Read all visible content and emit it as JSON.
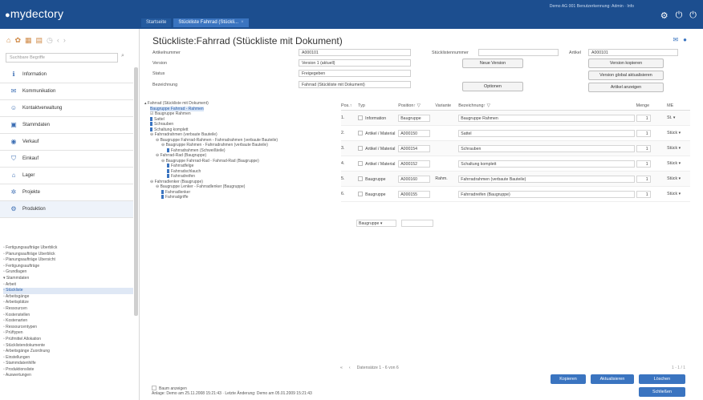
{
  "app": {
    "logo": "mydectory",
    "user_info": "Demo AG 001 Benutzerkennung: Admin · Info"
  },
  "tabs": [
    {
      "label": "Startseite"
    },
    {
      "label": "Stückliste Fahrrad (Stückli...",
      "close": "×"
    }
  ],
  "sidebar": {
    "search_placeholder": "Suchbare Begriffe",
    "items": [
      {
        "icon": "info-icon",
        "label": "Information"
      },
      {
        "icon": "communication-icon",
        "label": "Kommunikation"
      },
      {
        "icon": "contacts-icon",
        "label": "Kontaktverwaltung"
      },
      {
        "icon": "masterdata-icon",
        "label": "Stammdaten"
      },
      {
        "icon": "sales-icon",
        "label": "Verkauf"
      },
      {
        "icon": "purchase-icon",
        "label": "Einkauf"
      },
      {
        "icon": "warehouse-icon",
        "label": "Lager"
      },
      {
        "icon": "projects-icon",
        "label": "Projekte"
      },
      {
        "icon": "production-icon",
        "label": "Produktion"
      }
    ],
    "tree": [
      "▫ Fertigungsaufträge Überblick",
      "▫ Planungsaufträge Überblick",
      "▫ Planungsaufträge Übersicht",
      "▫ Fertigungsaufträge",
      "  ▫ Grundlagen",
      "  ▾ Stammdaten",
      "    ▫ Arbeit",
      "    ▫ Stückliste",
      "    ▫ Arbeitsgänge",
      "    ▫ Arbeitsplätze",
      "    ▫ Ressourcen",
      "    ▫ Kostenstellen",
      "    ▫ Kostenarten",
      "    ▫ Ressourcentypen",
      "    ▫ Prüftypen",
      "    ▫ Prüfmittel Allokation",
      "    ▫ Stücklistendokumente",
      "    ▫ Arbeitsgänge Zuordnung",
      "  ▫ Einstellungen",
      "  ▫ Stammdatenhilfe",
      "▫ Produktionsliste",
      "▫ Auswertungen"
    ],
    "tree_selected": 7
  },
  "main": {
    "title": "Stückliste:Fahrrad (Stückliste mit Dokument)",
    "fields": {
      "artikelnummer_label": "Artikelnummer",
      "artikelnummer": "A000101",
      "version_label": "Version",
      "version": "Version 1 (aktuell)",
      "status_label": "Status",
      "status": "Freigegeben",
      "bezeichnung_label": "Bezeichnung",
      "bezeichnung": "Fahrrad (Stückliste mit Dokument)",
      "stuecklistennummer_label": "Stücklistennummer",
      "stuecklistennummer": "",
      "artikel_label": "Artikel",
      "artikel": "A000101"
    },
    "buttons": {
      "neue_version": "Neue Version",
      "optionen": "Optionen",
      "version_kopieren": "Version kopieren",
      "version_global": "Version global aktualisieren",
      "artikel_anzeigen": "Artikel anzeigen"
    },
    "tree": [
      {
        "t": "▴ Fahrrad (Stückliste mit Dokument)",
        "i": 0,
        "sel": false
      },
      {
        "t": "Baugruppe Fahrrad - Rahmen",
        "i": 1,
        "sel": true
      },
      {
        "t": "☑ Baugruppe Rahmen",
        "i": 1,
        "sel": false
      },
      {
        "t": "Sattel",
        "i": 1,
        "leaf": true
      },
      {
        "t": "Schrauben",
        "i": 1,
        "leaf": true
      },
      {
        "t": "Schaltung komplett",
        "i": 1,
        "leaf": true
      },
      {
        "t": "⊖ Fahrradrahmen (verbaute Bauteile)",
        "i": 1
      },
      {
        "t": "⊖ Baugruppe Fahrrad-Rahmen - Fahrradrahmen (verbaute Bauteile)",
        "i": 2
      },
      {
        "t": "⊖ Baugruppe Rahmen - Fahrradrahmen (verbaute Bauteile)",
        "i": 3
      },
      {
        "t": "Fahrradrahmen (Schweißteile)",
        "i": 4,
        "leaf": true
      },
      {
        "t": "⊖ Fahrrad-Rad (Baugruppe)",
        "i": 2
      },
      {
        "t": "⊖ Baugruppe Fahrrad-Rad - Fahrrad-Rad (Baugruppe)",
        "i": 3
      },
      {
        "t": "Fahrradfelge",
        "i": 4,
        "leaf": true
      },
      {
        "t": "Fahrradschlauch",
        "i": 4,
        "leaf": true
      },
      {
        "t": "Fahrradreifen",
        "i": 4,
        "leaf": true
      },
      {
        "t": "⊖ Fahrradlenker (Baugruppe)",
        "i": 1
      },
      {
        "t": "⊖ Baugruppe Lenker - Fahrradlenker (Baugruppe)",
        "i": 2
      },
      {
        "t": "Fahrradlenker",
        "i": 3,
        "leaf": true
      },
      {
        "t": "Fahrradgriffe",
        "i": 3,
        "leaf": true
      }
    ],
    "table": {
      "headers": [
        "Pos.↑",
        "Typ",
        "Position↑ ▽",
        "Variante",
        "Bezeichnung↑ ▽",
        "Menge",
        "ME"
      ],
      "rows": [
        {
          "pos": "1.",
          "typ": "Information",
          "position": "Baugruppe",
          "variante": "",
          "bez": "Baugruppe Rahmen",
          "menge": "1",
          "me": "St."
        },
        {
          "pos": "2.",
          "typ": "Artikel / Material",
          "position": "A000150",
          "variante": "",
          "bez": "Sattel",
          "menge": "1",
          "me": "Stück"
        },
        {
          "pos": "3.",
          "typ": "Artikel / Material",
          "position": "A000154",
          "variante": "",
          "bez": "Schrauben",
          "menge": "1",
          "me": "Stück"
        },
        {
          "pos": "4.",
          "typ": "Artikel / Material",
          "position": "A000152",
          "variante": "",
          "bez": "Schaltung komplett",
          "menge": "1",
          "me": "Stück"
        },
        {
          "pos": "5.",
          "typ": "Baugruppe",
          "position": "A000160",
          "variante": "Rahm.",
          "bez": "Fahrradrahmen (verbaute Bauteile)",
          "menge": "1",
          "me": "Stück"
        },
        {
          "pos": "6.",
          "typ": "Baugruppe",
          "position": "A000155",
          "variante": "",
          "bez": "Fahrradreifen (Baugruppe)",
          "menge": "1",
          "me": "Stück"
        }
      ],
      "add_row": {
        "typ": "Baugruppe ▾",
        "position": ""
      }
    },
    "pager": {
      "text": "Datensätze 1 - 6 von 6",
      "right": "1 - 1 / 1"
    },
    "bottom_buttons": {
      "kopieren": "Kopieren",
      "aktualisieren": "Aktualisieren",
      "loeschen": "Löschen",
      "schliessen": "Schließen"
    },
    "footer": {
      "checkbox": "Baum anzeigen",
      "meta": "Anlage: Demo am 25.11.2008 15:21:43 · Letzte Änderung: Demo am 05.01.2009 15:21:43"
    }
  },
  "colors": {
    "topbar": "#1c4e8f",
    "accent": "#3a74c0"
  }
}
